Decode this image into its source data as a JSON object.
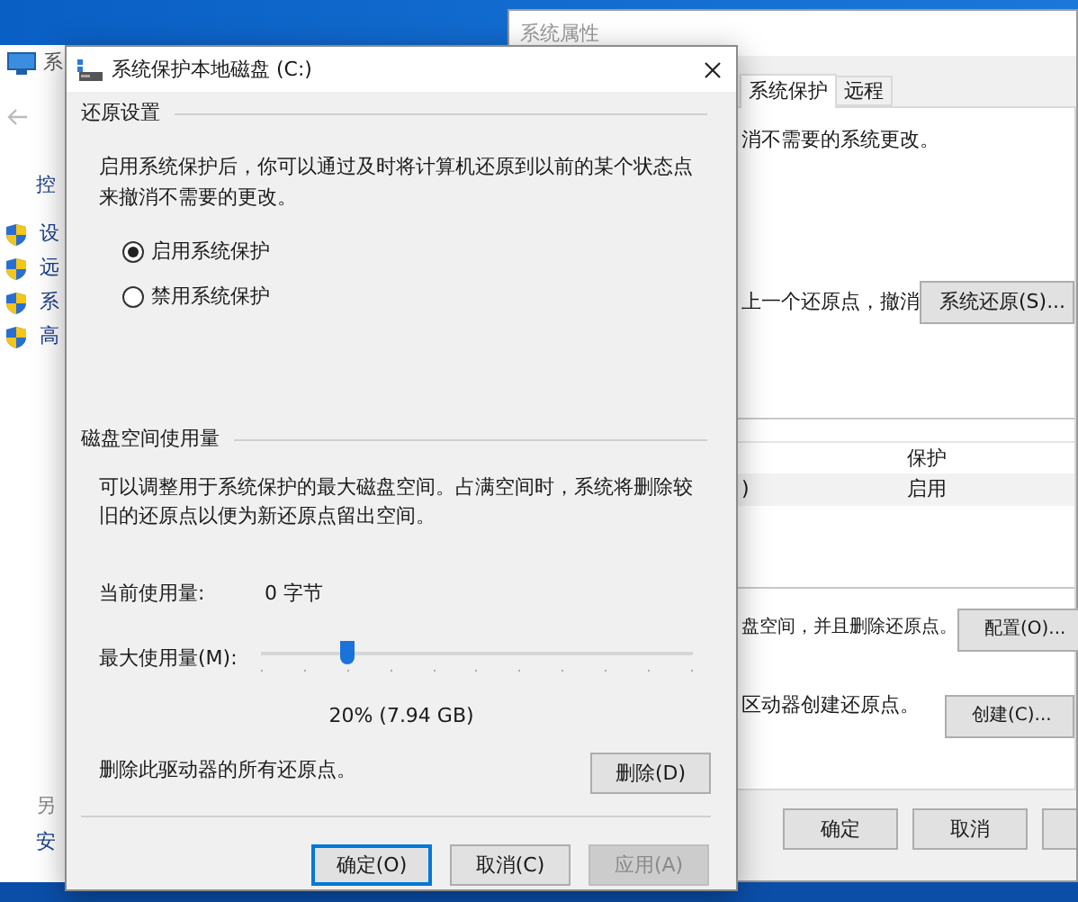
{
  "control_panel": {
    "title": "系",
    "nav_label": "控",
    "links": [
      "设",
      "远",
      "系",
      "高"
    ],
    "footer": [
      "另",
      "安"
    ]
  },
  "system_properties": {
    "title": "系统属性",
    "tabs": [
      {
        "label": "系统保护",
        "selected": true
      },
      {
        "label": "远程",
        "selected": false
      }
    ],
    "intro": "消不需要的系统更改。",
    "restore_text": "上一个还原点，撤消",
    "restore_button": "系统还原(S)...",
    "table": {
      "columns": [
        "保护"
      ],
      "rows": [
        {
          "column_1": ")",
          "protection": "启用"
        }
      ]
    },
    "configure_text": "盘空间，并且删除还原点。",
    "configure_button": "配置(O)...",
    "create_text": "区动器创建还原点。",
    "create_button": "创建(C)...",
    "buttons": [
      {
        "label": "确定"
      },
      {
        "label": "取消"
      }
    ]
  },
  "dialog": {
    "title": "系统保护本地磁盘 (C:)",
    "restore_settings": {
      "heading": "还原设置",
      "description": "启用系统保护后，你可以通过及时将计算机还原到以前的某个状态点来撤消不需要的更改。",
      "options": [
        {
          "label": "启用系统保护",
          "selected": true
        },
        {
          "label": "禁用系统保护",
          "selected": false
        }
      ]
    },
    "disk_usage": {
      "heading": "磁盘空间使用量",
      "description": "可以调整用于系统保护的最大磁盘空间。占满空间时，系统将删除较旧的还原点以便为新还原点留出空间。",
      "current_label": "当前使用量:",
      "current_value": "0 字节",
      "max_label": "最大使用量(M):",
      "slider": {
        "level": 0.2
      },
      "reading": "20% (7.94 GB)",
      "delete_text": "删除此驱动器的所有还原点。",
      "delete_button": "删除(D)"
    },
    "buttons": [
      {
        "label": "确定(O)",
        "focused": true,
        "disabled": false
      },
      {
        "label": "取消(C)",
        "focused": false,
        "disabled": false
      },
      {
        "label": "应用(A)",
        "focused": false,
        "disabled": true
      }
    ]
  }
}
